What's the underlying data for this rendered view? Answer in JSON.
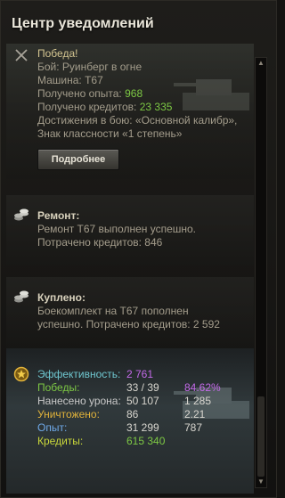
{
  "header": {
    "title": "Центр уведомлений"
  },
  "victory": {
    "title": "Победа!",
    "battle": "Бой: Руинберг в огне",
    "vehicle": "Машина: T67",
    "xp_label": "Получено опыта: ",
    "xp_value": "968",
    "credits_label": "Получено кредитов: ",
    "credits_value": "23 335",
    "achievements_line1": "Достижения в бою: «Основной калибр»,",
    "achievements_line2": "Знак классности «1 степень»",
    "details_button": "Подробнее"
  },
  "repair": {
    "title": "Ремонт:",
    "line1": "Ремонт T67 выполнен успешно.",
    "line2": "Потрачено кредитов:  846"
  },
  "purchase": {
    "title": "Куплено:",
    "line1": "Боекомплект на T67 пополнен",
    "line2": "успешно. Потрачено кредитов:  2 592"
  },
  "stats": {
    "efficiency_label": "Эффективность:",
    "efficiency_value": "2 761",
    "wins_label": "Победы:",
    "wins_value": "33 / 39",
    "wins_pct": "84.62%",
    "damage_label": "Нанесено урона:",
    "damage_value": "50 107",
    "damage_avg": "1 285",
    "kills_label": "Уничтожено:",
    "kills_value": "86",
    "kills_avg": "2.21",
    "xp_label": "Опыт:",
    "xp_value": "31 299",
    "xp_avg": "787",
    "credits_label": "Кредиты:",
    "credits_value": "615 340"
  },
  "colors": {
    "accent_green": "#7dc844",
    "purple": "#c36ae8",
    "gold": "#e0b23a"
  },
  "icons": [
    "crossed-swords-icon",
    "coins-icon",
    "coins-icon",
    "medal-icon"
  ]
}
